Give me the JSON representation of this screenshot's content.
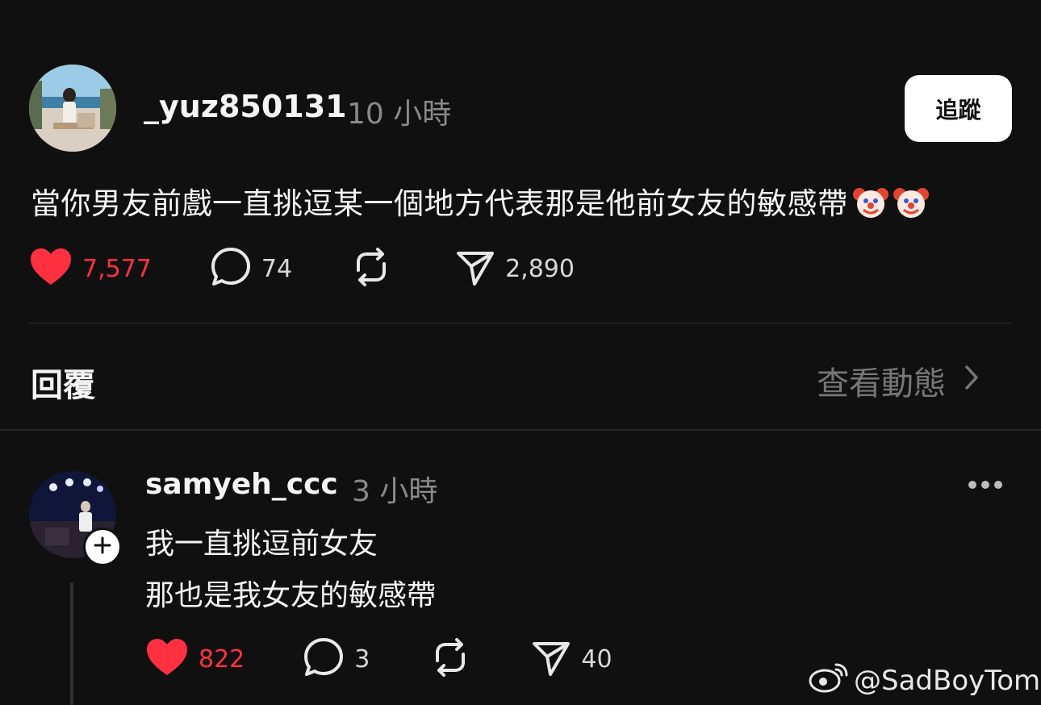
{
  "post": {
    "username": "_yuz850131",
    "time": "10 小時",
    "follow_label": "追蹤",
    "text": "當你男友前戲一直挑逗某一個地方代表那是他前女友的敏感帶",
    "likes": "7,577",
    "comments": "74",
    "shares": "2,890",
    "icons": [
      "heart-filled-icon",
      "comment-icon",
      "repost-icon",
      "send-icon",
      "clown-emoji-icon"
    ],
    "like_color": "#ff3040"
  },
  "replies_section": {
    "heading": "回覆",
    "view_activity_label": "查看動態"
  },
  "reply": {
    "username": "samyeh_ccc",
    "time": "3 小時",
    "lines": [
      "我一直挑逗前女友",
      "那也是我女友的敏感帶"
    ],
    "likes": "822",
    "comments": "3",
    "shares": "40"
  },
  "watermark": "@SadBoyTom"
}
